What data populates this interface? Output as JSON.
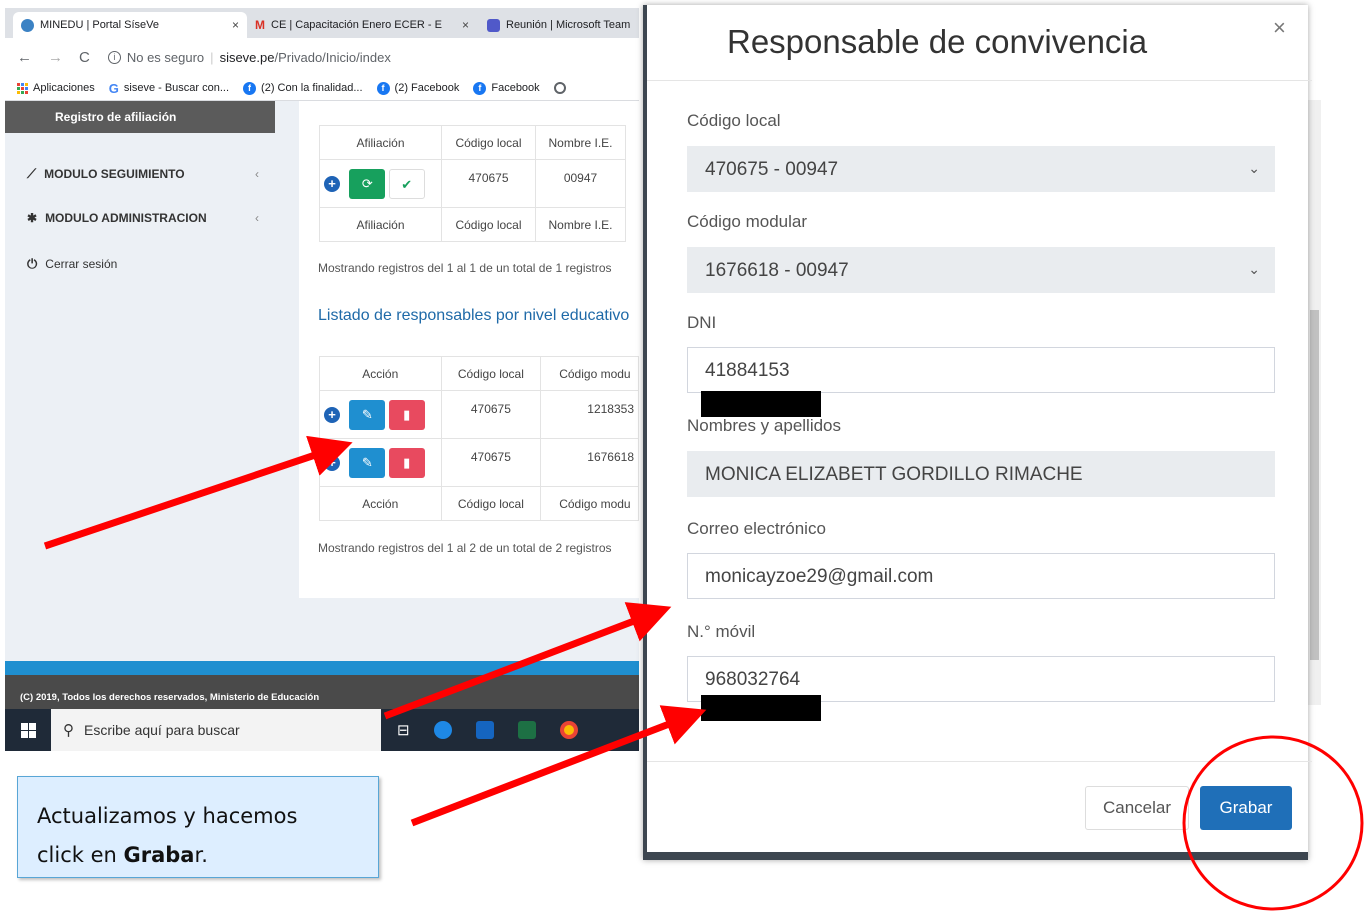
{
  "browser": {
    "tabs": [
      {
        "title": "MINEDU | Portal SíseVe",
        "close": "×"
      },
      {
        "title": "CE | Capacitación Enero ECER - E",
        "close": "×"
      },
      {
        "title": "Reunión | Microsoft Team"
      }
    ],
    "security_label": "No es seguro",
    "url_host": "siseve.pe",
    "url_path": "/Privado/Inicio/index",
    "bookmarks": [
      "Aplicaciones",
      "siseve - Buscar con...",
      "(2) Con la finalidad...",
      "(2) Facebook",
      "Facebook"
    ]
  },
  "sidebar": {
    "section": "Registro de afiliación",
    "items": [
      {
        "label": "MODULO SEGUIMIENTO",
        "chevron": "‹"
      },
      {
        "label": "MODULO ADMINISTRACION",
        "chevron": "‹"
      },
      {
        "label": "Cerrar sesión"
      }
    ]
  },
  "affiliation_table": {
    "headers": [
      "Afiliación",
      "Código local",
      "Nombre I.E."
    ],
    "row": {
      "local": "470675",
      "name": "00947"
    },
    "info": "Mostrando registros del 1 al 1 de un total de 1 registros"
  },
  "responsables": {
    "title": "Listado de responsables por nivel educativo",
    "headers": [
      "Acción",
      "Código local",
      "Código modu"
    ],
    "rows": [
      {
        "local": "470675",
        "modular": "1218353"
      },
      {
        "local": "470675",
        "modular": "1676618"
      }
    ],
    "info": "Mostrando registros del 1 al 2 de un total de 2 registros"
  },
  "footer": {
    "copyright": "(C) 2019, Todos los derechos reservados, Ministerio de Educación"
  },
  "taskbar": {
    "search_placeholder": "Escribe aquí para buscar"
  },
  "modal": {
    "title": "Responsable de convivencia",
    "close": "×",
    "fields": {
      "codigo_local": {
        "label": "Código local",
        "value": "470675 - 00947"
      },
      "codigo_modular": {
        "label": "Código modular",
        "value": "1676618 - 00947"
      },
      "dni": {
        "label": "DNI",
        "value": "41884153"
      },
      "nombres": {
        "label": "Nombres y apellidos",
        "value": "MONICA ELIZABETT GORDILLO RIMACHE"
      },
      "correo": {
        "label": "Correo electrónico",
        "value": "monicayzoe29@gmail.com"
      },
      "movil": {
        "label": "N.° móvil",
        "value": "968032764"
      }
    },
    "cancel_label": "Cancelar",
    "save_label": "Grabar"
  },
  "callout": {
    "line1": "Actualizamos  y hacemos",
    "line2_pre": "click en ",
    "line2_bold": "Graba",
    "line2_post": "r."
  },
  "colors": {
    "accent_blue": "#1f6fb8",
    "annotation_red": "#ff0000",
    "success_green": "#17a05d",
    "danger_red": "#e84a5f"
  }
}
